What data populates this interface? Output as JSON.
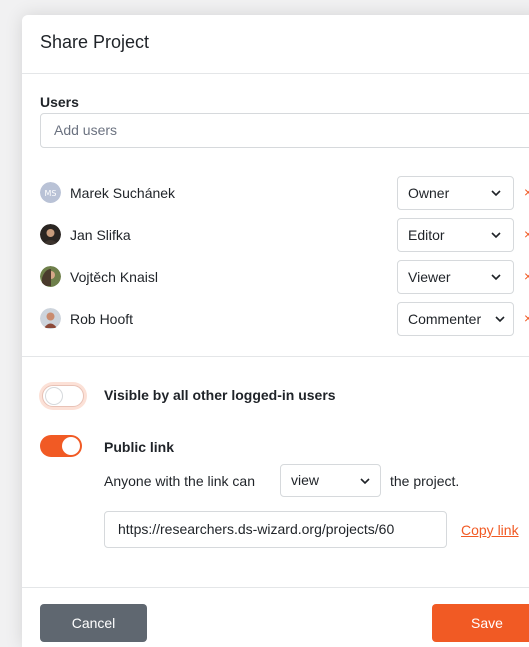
{
  "dialog": {
    "title": "Share Project"
  },
  "users": {
    "label": "Users",
    "placeholder": "Add users",
    "remove_glyph": "×",
    "list": [
      {
        "name": "Marek Suchánek",
        "role": "Owner",
        "avatar": "initials-avatar"
      },
      {
        "name": "Jan Slifka",
        "role": "Editor",
        "avatar": "photo-avatar"
      },
      {
        "name": "Vojtěch Knaisl",
        "role": "Viewer",
        "avatar": "photo-avatar"
      },
      {
        "name": "Rob Hooft",
        "role": "Commenter",
        "avatar": "photo-avatar"
      }
    ]
  },
  "visibility": {
    "label": "Visible by all other logged-in users",
    "enabled": false
  },
  "public_link": {
    "label": "Public link",
    "enabled": true,
    "sentence_before": "Anyone with the link can",
    "permission": "view",
    "sentence_after": "the project.",
    "url": "https://researchers.ds-wizard.org/projects/60",
    "copy_label": "Copy link"
  },
  "footer": {
    "cancel_label": "Cancel",
    "save_label": "Save"
  },
  "colors": {
    "accent": "#f15a24",
    "cancel": "#5f6770"
  }
}
